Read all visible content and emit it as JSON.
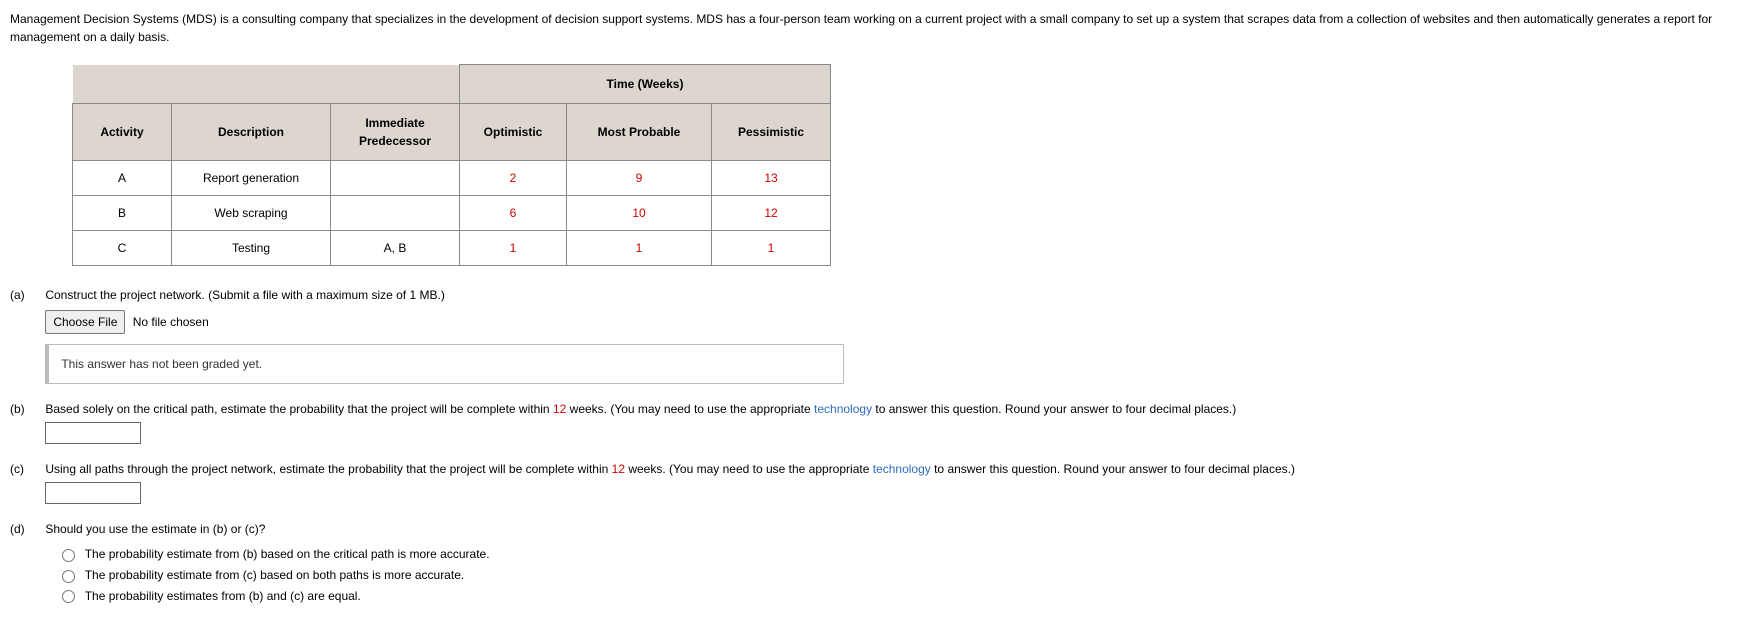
{
  "intro": "Management Decision Systems (MDS) is a consulting company that specializes in the development of decision support systems. MDS has a four-person team working on a current project with a small company to set up a system that scrapes data from a collection of websites and then automatically generates a report for management on a daily basis.",
  "table": {
    "time_header": "Time (Weeks)",
    "col_activity": "Activity",
    "col_description": "Description",
    "col_predecessor": "Immediate Predecessor",
    "col_optimistic": "Optimistic",
    "col_most_probable": "Most Probable",
    "col_pessimistic": "Pessimistic",
    "rows": [
      {
        "activity": "A",
        "desc": "Report generation",
        "pred": "",
        "opt": "2",
        "most": "9",
        "pess": "13"
      },
      {
        "activity": "B",
        "desc": "Web scraping",
        "pred": "",
        "opt": "6",
        "most": "10",
        "pess": "12"
      },
      {
        "activity": "C",
        "desc": "Testing",
        "pred": "A, B",
        "opt": "1",
        "most": "1",
        "pess": "1"
      }
    ]
  },
  "parts": {
    "a": {
      "label": "(a)",
      "text": "Construct the project network. (Submit a file with a maximum size of 1 MB.)",
      "choose_file": "Choose File",
      "no_file": "No file chosen",
      "grade_msg": "This answer has not been graded yet."
    },
    "b": {
      "label": "(b)",
      "text_pre": "Based solely on the critical path, estimate the probability that the project will be complete within ",
      "weeks_num": "12",
      "text_mid": " weeks. (You may need to use the appropriate ",
      "tech": "technology",
      "text_post": " to answer this question. Round your answer to four decimal places.)"
    },
    "c": {
      "label": "(c)",
      "text_pre": "Using all paths through the project network, estimate the probability that the project will be complete within ",
      "weeks_num": "12",
      "text_mid": " weeks. (You may need to use the appropriate ",
      "tech": "technology",
      "text_post": " to answer this question. Round your answer to four decimal places.)"
    },
    "d": {
      "label": "(d)",
      "text": "Should you use the estimate in (b) or (c)?",
      "opt1": "The probability estimate from (b) based on the critical path is more accurate.",
      "opt2": "The probability estimate from (c) based on both paths is more accurate.",
      "opt3": "The probability estimates from (b) and (c) are equal."
    }
  }
}
